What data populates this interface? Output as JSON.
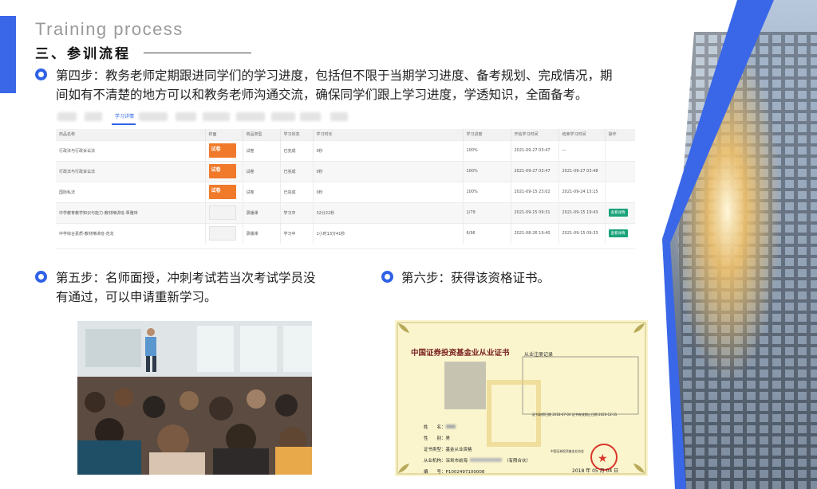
{
  "header": {
    "en_title": "Training process",
    "cn_title": "三、参训流程"
  },
  "step4": {
    "line1": "第四步：教务老师定期跟进同学们的学习进度，包括但不限于当期学习进度、备考规划、完成情况，期",
    "line2": "间如有不清楚的地方可以和教务老师沟通交流，确保同学们跟上学习进度，学透知识，全面备考。"
  },
  "table": {
    "active_tab": "学习详情",
    "headers": [
      "商品名称",
      "封面",
      "商品类型",
      "学习状态",
      "学习时长",
      "学习进度",
      "开始学习时间",
      "结束学习时间",
      "操作"
    ],
    "rows": [
      {
        "name": "行政法与行政诉讼法",
        "cover": "试卷",
        "type": "试卷",
        "status": "已完成",
        "duration": "0秒",
        "progress": "100%",
        "start": "2021-09-27 03:47",
        "end": "—",
        "op": ""
      },
      {
        "name": "行政法与行政诉讼法",
        "cover": "试卷",
        "type": "试卷",
        "status": "已完成",
        "duration": "0秒",
        "progress": "100%",
        "start": "2021-09-27 03:47",
        "end": "2021-09-27 03:48",
        "op": ""
      },
      {
        "name": "国际私法",
        "cover": "试卷",
        "type": "试卷",
        "status": "已完成",
        "duration": "0秒",
        "progress": "100%",
        "start": "2021-09-15 23:02",
        "end": "2021-09-24 15:15",
        "op": ""
      },
      {
        "name": "中学教育教学知识与能力-教材精讲班-覃雅林",
        "cover": "",
        "type": "录播课",
        "status": "学习中",
        "duration": "32分22秒",
        "progress": "1/79",
        "start": "2021-09-15 09:31",
        "end": "2021-09-15 19:43",
        "op": "查看详情"
      },
      {
        "name": "中学综合素质-教材精讲班-范龙",
        "cover": "",
        "type": "录播课",
        "status": "学习中",
        "duration": "1小时13分41秒",
        "progress": "6/96",
        "start": "2021-08-26 19:40",
        "end": "2021-09-15 09:33",
        "op": "查看详情"
      }
    ]
  },
  "step5": {
    "line1": "第五步：名师面授，冲刺考试若当次考试学员没",
    "line2": "有通过，可以申请重新学习。"
  },
  "step6": {
    "text": "第六步：获得该资格证书。"
  },
  "certificate": {
    "title": "中国证券投资基金业从业证书",
    "record_title": "从业注册记录",
    "reg_line": "证书取得日期 2018-07-04   证书有效期止日期 2020-12-31",
    "fields": [
      {
        "label": "姓　　名：",
        "value": ""
      },
      {
        "label": "性　　别：",
        "value": "男"
      },
      {
        "label": "证书类型：",
        "value": "基金从业资格"
      },
      {
        "label": "从业机构：",
        "value": "深圳市前海"
      },
      {
        "label": "编　　号：",
        "value": "P1002497100008"
      }
    ],
    "org_suffix": "（有限合伙）",
    "issuer": "中国证券投资基金业协会",
    "date": "2018 年 05 月 04 日"
  },
  "colors": {
    "accent": "#2f62e6",
    "accent_bar": "#3a67e8",
    "cover_orange": "#f07a2a",
    "op_green": "#19a37a",
    "seal_red": "#d9352c"
  }
}
